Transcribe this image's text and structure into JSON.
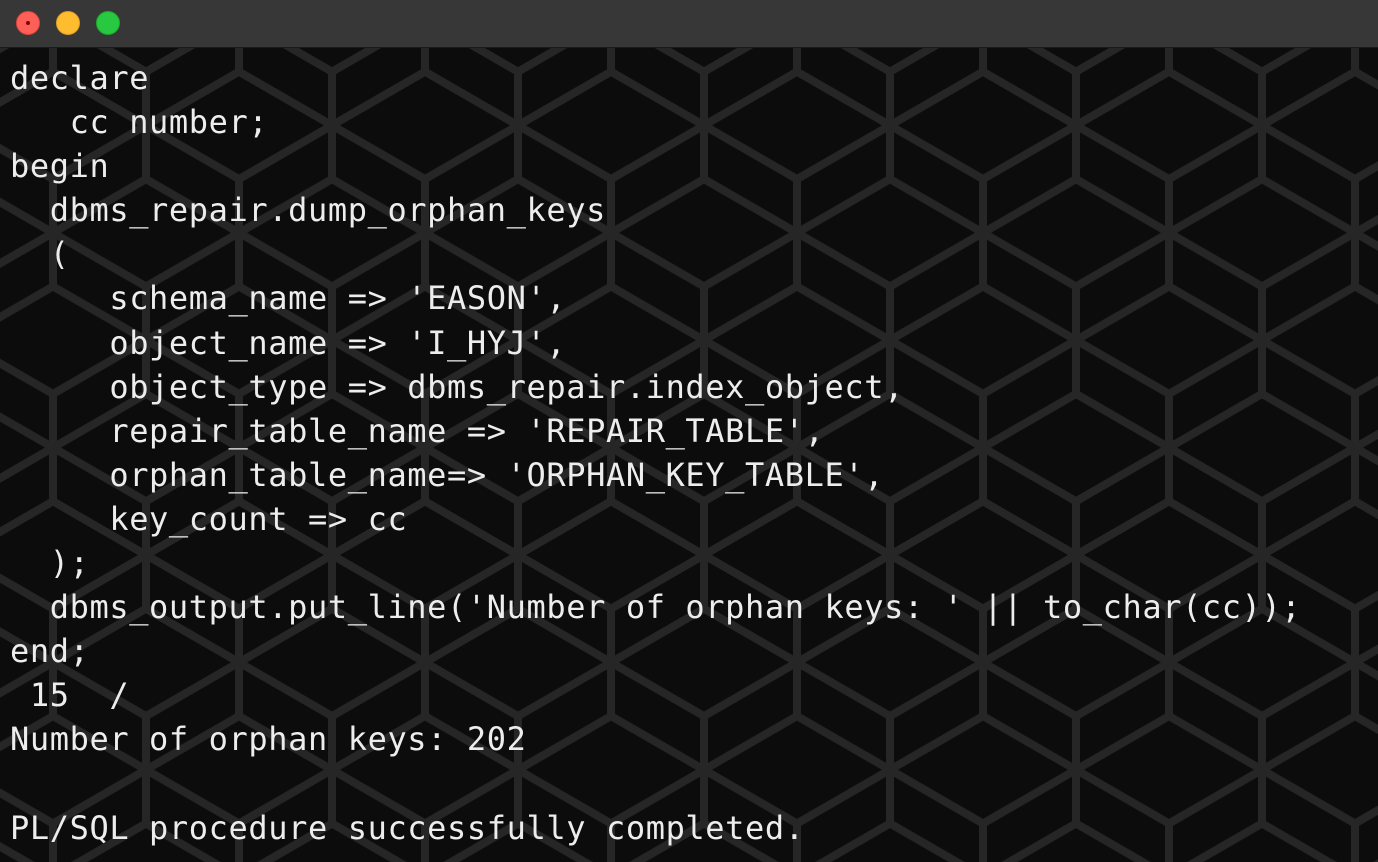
{
  "window": {
    "controls": {
      "close": "close-button",
      "minimize": "minimize-button",
      "maximize": "maximize-button"
    }
  },
  "terminal": {
    "lines": [
      "declare",
      "   cc number;",
      "begin",
      "  dbms_repair.dump_orphan_keys",
      "  (",
      "     schema_name => 'EASON',",
      "     object_name => 'I_HYJ',",
      "     object_type => dbms_repair.index_object,",
      "     repair_table_name => 'REPAIR_TABLE',",
      "     orphan_table_name=> 'ORPHAN_KEY_TABLE',",
      "     key_count => cc",
      "  );",
      "  dbms_output.put_line('Number of orphan keys: ' || to_char(cc));",
      "end;",
      " 15  /",
      "Number of orphan keys: 202",
      "",
      "PL/SQL procedure successfully completed."
    ]
  },
  "colors": {
    "titlebar": "#373737",
    "background": "#0c0c0c",
    "text": "#ededed",
    "hex_stroke": "#262626",
    "close": "#fe5f57",
    "minimize": "#febc2e",
    "maximize": "#28c840"
  }
}
